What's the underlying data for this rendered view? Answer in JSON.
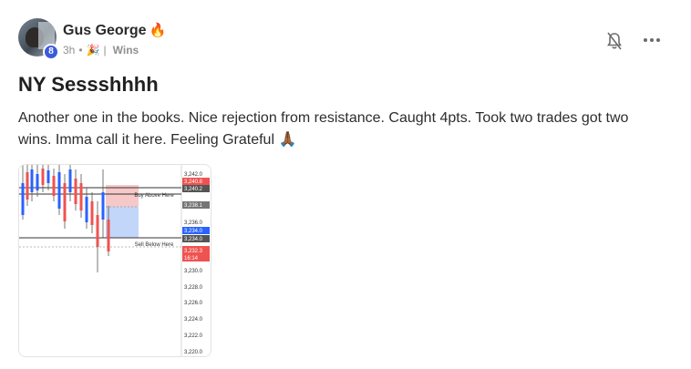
{
  "post": {
    "author": "Gus George",
    "author_emoji": "🔥",
    "level": "8",
    "time": "3h",
    "category_emoji": "🎉",
    "category": "Wins",
    "title": "NY Sessshhhh",
    "body": "Another one in the books. Nice rejection from resistance. Caught 4pts. Took two trades got two wins. Imma call it here. Feeling Grateful 🙏🏾"
  },
  "icons": {
    "bell": "bell-slash-icon",
    "more": "more-horizontal-icon"
  },
  "trade_image": {
    "labels": {
      "buy": "Buy Above Here",
      "sell": "Sell Below Here"
    },
    "price_scale": [
      "3,242.0",
      "3,240.8",
      "3,240.2",
      "3,238.1",
      "3,236.0",
      "3,234.0",
      "3,234.0",
      "3,232.3",
      "16:14",
      "3,230.0",
      "3,228.0",
      "3,226.0",
      "3,224.0",
      "3,222.0",
      "3,220.0"
    ],
    "price_tags": [
      {
        "text": "3,240.8",
        "color": "#ef5350"
      },
      {
        "text": "3,240.2",
        "color": "#555555"
      },
      {
        "text": "3,238.1",
        "color": "#757575"
      },
      {
        "text": "3,234.0",
        "color": "#2962ff"
      },
      {
        "text": "3,234.0",
        "color": "#555555"
      },
      {
        "text": "3,232.3",
        "color": "#ef5350"
      }
    ]
  }
}
